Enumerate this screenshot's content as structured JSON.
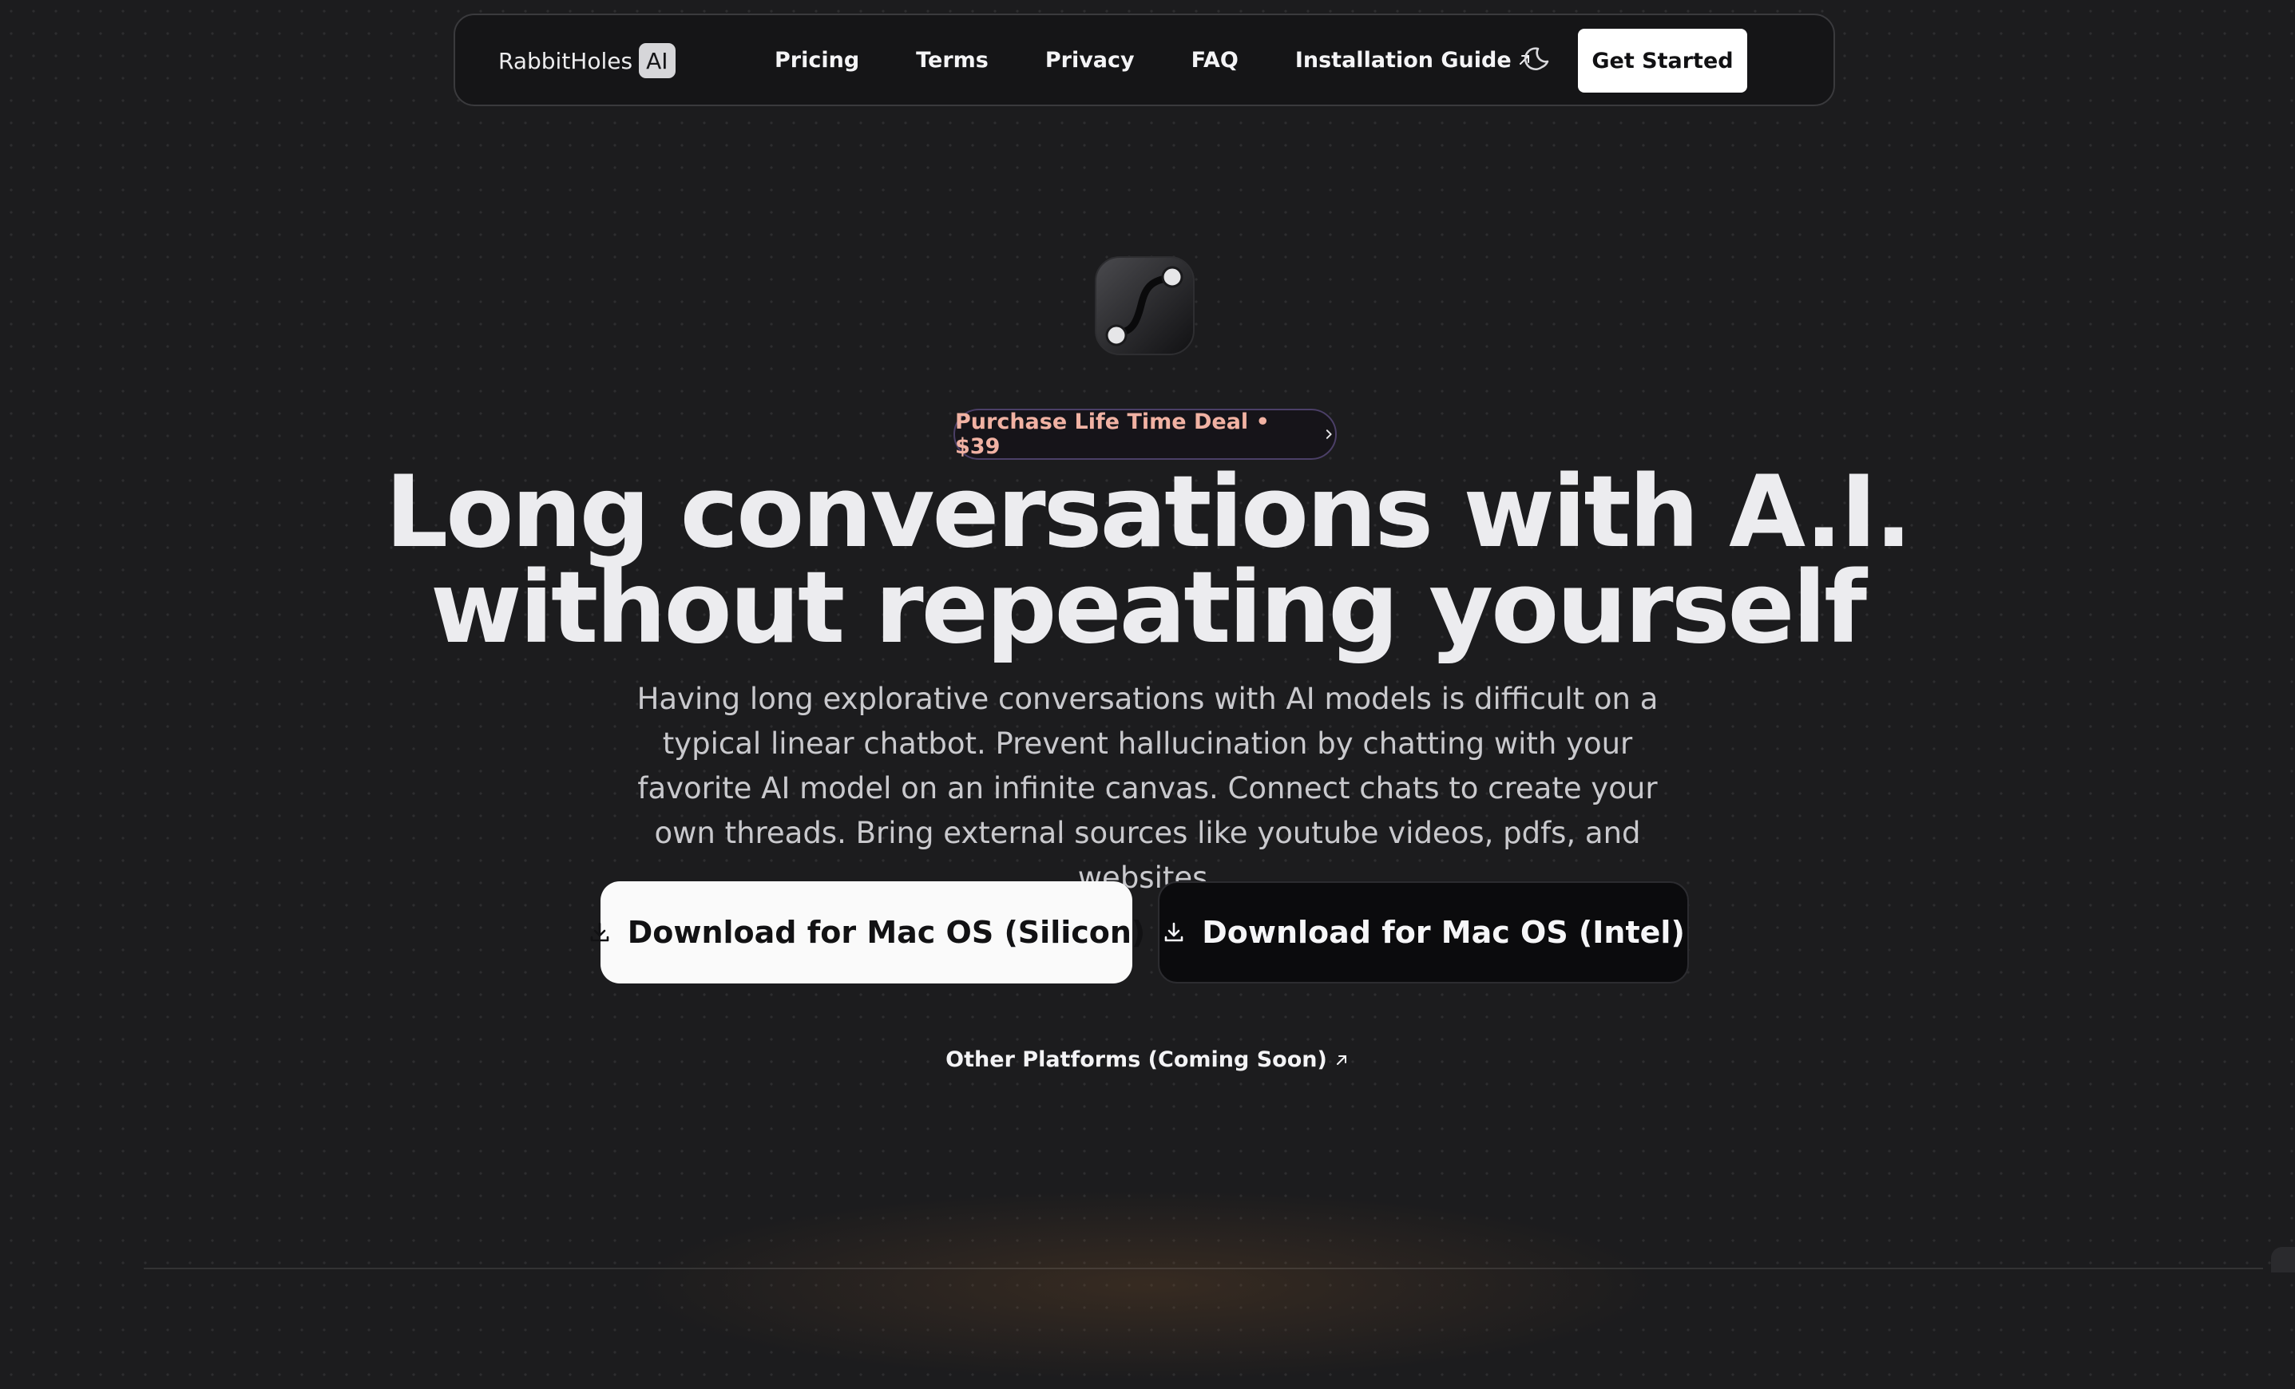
{
  "nav": {
    "brand_name": "RabbitHoles",
    "brand_badge": "AI",
    "links": [
      {
        "label": "Pricing"
      },
      {
        "label": "Terms"
      },
      {
        "label": "Privacy"
      },
      {
        "label": "FAQ"
      },
      {
        "label": "Installation Guide",
        "external": true
      }
    ],
    "theme_toggle_icon": "moon-icon",
    "cta_label": "Get Started"
  },
  "hero": {
    "app_icon": "app-logo-icon",
    "deal_label": "Purchase Life Time Deal • $39",
    "headline_line1": "Long conversations with A.I.",
    "headline_line2": "without repeating yourself",
    "subtext": "Having long explorative conversations with AI models is difficult on a typical linear chatbot. Prevent hallucination by chatting with your favorite AI model on an infinite canvas. Connect chats to create your own threads. Bring external sources like youtube videos, pdfs, and websites.",
    "download_silicon": "Download for Mac OS (Silicon)",
    "download_intel": "Download for Mac OS (Intel)",
    "other_platforms": "Other Platforms (Coming Soon)"
  },
  "colors": {
    "background": "#1c1c1e",
    "nav_background": "#151517",
    "deal_text": "#f1b2a3",
    "deal_border": "#4b3f67",
    "primary_button": "#fafafa",
    "secondary_button": "#0b0b0d"
  }
}
